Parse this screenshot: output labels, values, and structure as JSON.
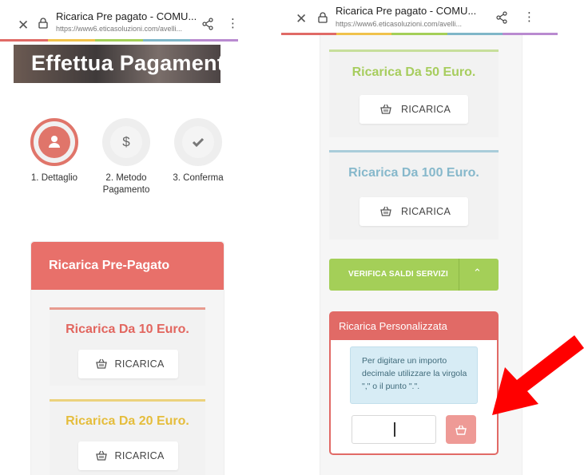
{
  "browser": {
    "title": "Ricarica Pre pagato - COMU...",
    "url": "https://www6.eticasoluzioni.com/avelli...",
    "stripe_colors": [
      "#e06a66",
      "#f0c24b",
      "#a4cf58",
      "#7fb6c8",
      "#b98ad0"
    ]
  },
  "left": {
    "hero_text": "Effettua Pagamento",
    "steps": [
      {
        "label": "1. Dettaglio",
        "icon": "user-icon"
      },
      {
        "label": "2. Metodo Pagamento",
        "icon": "dollar-icon"
      },
      {
        "label": "3. Conferma",
        "icon": "check-icon"
      }
    ],
    "card_title": "Ricarica Pre-Pagato",
    "options": [
      {
        "title": "Ricarica Da 10 Euro.",
        "button": "RICARICA",
        "color": "#e2665f",
        "border": "#e89b8f"
      },
      {
        "title": "Ricarica Da 20 Euro.",
        "button": "RICARICA",
        "color": "#e5bd3c",
        "border": "#ecd27d"
      }
    ]
  },
  "right": {
    "options": [
      {
        "title": "Ricarica Da 50 Euro.",
        "button": "RICARICA",
        "color": "#a7cd5e",
        "border": "#c7df9b"
      },
      {
        "title": "Ricarica Da 100 Euro.",
        "button": "RICARICA",
        "color": "#86b8cb",
        "border": "#a9cdda"
      }
    ],
    "verifica_label": "VERIFICA SALDI SERVIZI",
    "personal": {
      "title": "Ricarica Personalizzata",
      "info": "Per digitare un importo decimale utilizzare la virgola \",\" o il punto \".\".",
      "amount_value": ""
    }
  },
  "colors": {
    "accent_red": "#e8706a",
    "green": "#a4cf58",
    "arrow": "#ff0000"
  }
}
